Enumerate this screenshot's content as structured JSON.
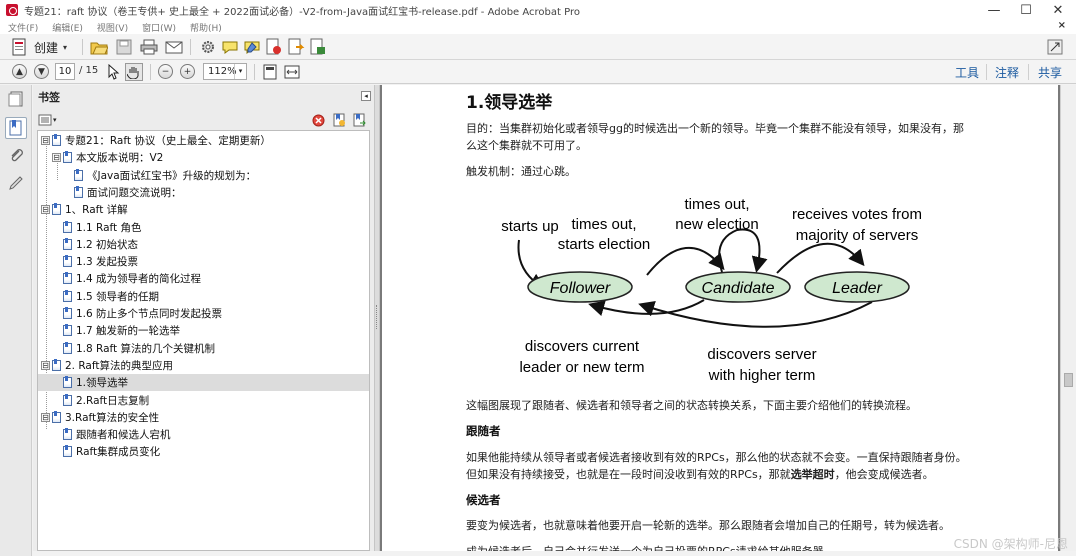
{
  "window": {
    "title": "专题21：raft 协议（卷王专供+ 史上最全 + 2022面试必备）-V2-from-Java面试红宝书-release.pdf - Adobe Acrobat Pro",
    "minimize": "—",
    "maximize": "☐",
    "close": "✕"
  },
  "menu": {
    "items": [
      "文件(F)",
      "编辑(E)",
      "视图(V)",
      "窗口(W)",
      "帮助(H)"
    ],
    "close_doc": "×"
  },
  "toolbar": {
    "create_label": "创建",
    "create_arrow": "▾",
    "page_current": "10",
    "page_total": "/ 15",
    "zoom": "112%",
    "zoom_arrow": "▾",
    "tools_label": "工具",
    "comment_label": "注释",
    "share_label": "共享"
  },
  "bookmarks": {
    "title": "书签",
    "collapse": "◂",
    "tools_arrow": "▾",
    "items": [
      {
        "label": "专题21：Raft 协议（史上最全、定期更新）",
        "expander": "⊟"
      },
      {
        "label": "本文版本说明：V2",
        "expander": "⊟"
      },
      {
        "label": "《Java面试红宝书》升级的规划为：",
        "expander": ""
      },
      {
        "label": "面试问题交流说明：",
        "expander": ""
      },
      {
        "label": "1、Raft 详解",
        "expander": "⊟"
      },
      {
        "label": "1.1 Raft 角色",
        "expander": ""
      },
      {
        "label": "1.2 初始状态",
        "expander": ""
      },
      {
        "label": "1.3 发起投票",
        "expander": ""
      },
      {
        "label": "1.4 成为领导者的简化过程",
        "expander": ""
      },
      {
        "label": "1.5 领导者的任期",
        "expander": ""
      },
      {
        "label": "1.6 防止多个节点同时发起投票",
        "expander": ""
      },
      {
        "label": "1.7  触发新的一轮选举",
        "expander": ""
      },
      {
        "label": "1.8 Raft 算法的几个关键机制",
        "expander": ""
      },
      {
        "label": "2. Raft算法的典型应用",
        "expander": "⊟"
      },
      {
        "label": "1.领导选举",
        "expander": ""
      },
      {
        "label": "2.Raft日志复制",
        "expander": ""
      },
      {
        "label": "3.Raft算法的安全性",
        "expander": "⊟"
      },
      {
        "label": "跟随者和候选人宕机",
        "expander": ""
      },
      {
        "label": "Raft集群成员变化",
        "expander": ""
      }
    ]
  },
  "document": {
    "heading": "1.领导选举",
    "p1_line1": "目的：当集群初始化或者领导gg的时候选出一个新的领导。毕竟一个集群不能没有领导，如果没有，那",
    "p1_line2": "么这个集群就不可用了。",
    "p2": "触发机制：通过心跳。",
    "diagram": {
      "states": [
        "Follower",
        "Candidate",
        "Leader"
      ],
      "edge_labels": {
        "starts_up": "starts up",
        "timeout_election_1": "times out,",
        "timeout_election_2": "starts election",
        "timeout_new_1": "times out,",
        "timeout_new_2": "new election",
        "receives_1": "receives votes from",
        "receives_2": "majority of servers",
        "discovers_current_1": "discovers current",
        "discovers_current_2": "leader or new term",
        "discovers_server_1": "discovers server",
        "discovers_server_2": "with higher term"
      },
      "state_fill": "#cfe8cf",
      "state_stroke": "#222222"
    },
    "p3": "这幅图展现了跟随者、候选者和领导者之间的状态转换关系，下面主要介绍他们的转换流程。",
    "h_follower": "跟随者",
    "p4_line1": "如果他能持续从领导者或者候选者接收到有效的RPCs，那么他的状态就不会变。一直保持跟随者身份。",
    "p4_line2_a": "但如果没有持续接受，也就是在一段时间没收到有效的RPCs，那就",
    "p4_line2_b": "选举超时",
    "p4_line2_c": "，他会变成候选者。",
    "h_candidate": "候选者",
    "p5": "要变为候选者，也就意味着他要开启一轮新的选举。那么跟随者会增加自己的任期号，转为候选者。",
    "p6": "成为候选者后，自己会并行发送一个为自己投票的RPCs请求给其他服务器。"
  },
  "watermark": "CSDN @架构师-尼恩"
}
